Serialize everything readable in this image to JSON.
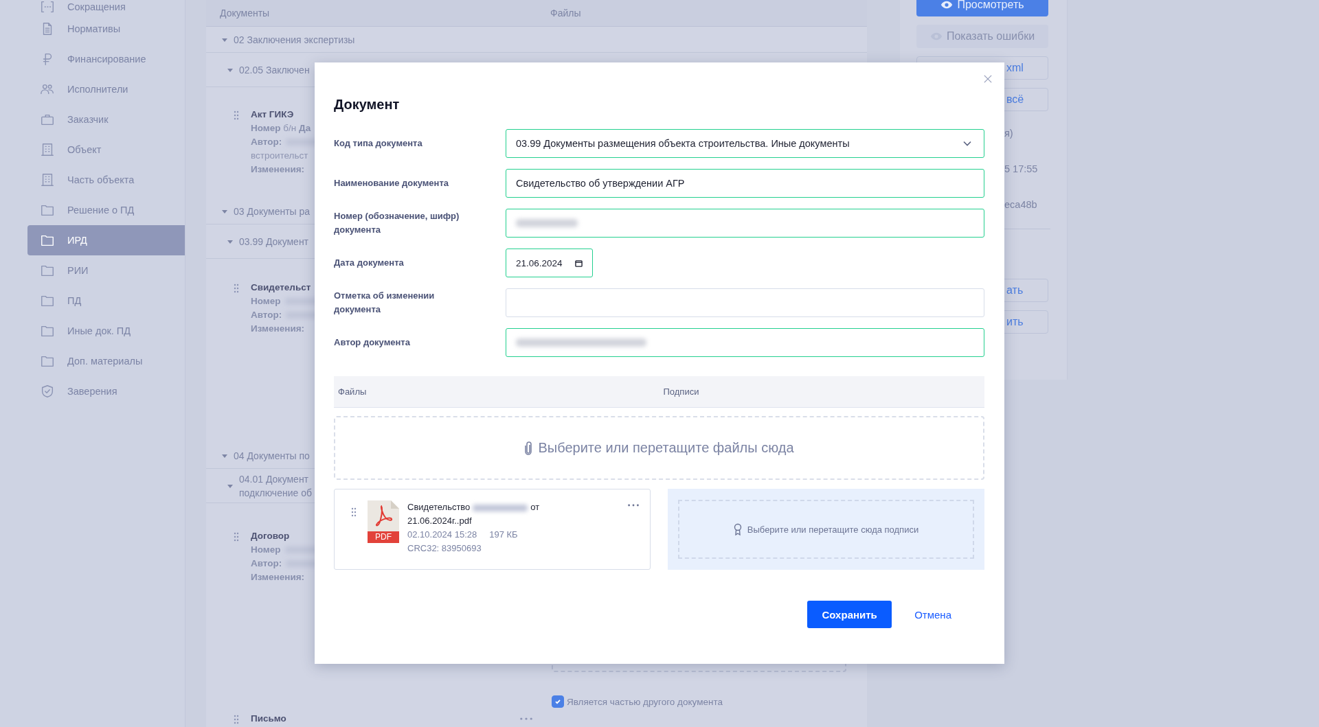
{
  "sidebar": {
    "items": [
      {
        "label": "Сокращения",
        "selected": false
      },
      {
        "label": "Нормативы",
        "selected": false
      },
      {
        "label": "Финансирование",
        "selected": false
      },
      {
        "label": "Исполнители",
        "selected": false
      },
      {
        "label": "Заказчик",
        "selected": false
      },
      {
        "label": "Объект",
        "selected": false
      },
      {
        "label": "Часть объекта",
        "selected": false
      },
      {
        "label": "Решение о ПД",
        "selected": false
      },
      {
        "label": "ИРД",
        "selected": true
      },
      {
        "label": "РИИ",
        "selected": false
      },
      {
        "label": "ПД",
        "selected": false
      },
      {
        "label": "Иные док. ПД",
        "selected": false
      },
      {
        "label": "Доп. материалы",
        "selected": false
      },
      {
        "label": "Заверения",
        "selected": false
      }
    ]
  },
  "documents": {
    "columns": [
      "Документы",
      "Файлы"
    ],
    "groups": [
      {
        "title": "02 Заключения экспертизы",
        "expanded": true,
        "children": [
          {
            "title": "02.05 Заключен",
            "expanded": true,
            "docs": [
              {
                "name": "Акт ГИКЭ",
                "lines": [
                  {
                    "text": "**Номер** б/н **Да**",
                    "redacted": false
                  },
                  {
                    "text": "**Автор:**",
                    "redacted": true
                  },
                  {
                    "text": "встроительст",
                    "redacted": false
                  },
                  {
                    "text": "**Изменения:**",
                    "redacted": false
                  }
                ]
              }
            ]
          }
        ]
      },
      {
        "title": "03 Документы ра",
        "expanded": true,
        "children": [
          {
            "title": "03.99 Документ",
            "expanded": true,
            "docs": [
              {
                "name": "Свидетельст",
                "lines": [
                  {
                    "text": "**Номер**",
                    "redacted": true
                  },
                  {
                    "text": "**Автор:**",
                    "redacted": true
                  },
                  {
                    "text": "**Изменения:**",
                    "redacted": false
                  }
                ]
              }
            ]
          }
        ]
      },
      {
        "title": "04 Документы по",
        "expanded": true,
        "children": [
          {
            "title": "04.01 Документ\nподключение об",
            "expanded": true,
            "docs": [
              {
                "name": "Договор",
                "lines": [
                  {
                    "text": "**Номер**",
                    "redacted": true
                  },
                  {
                    "text": "**Автор:**",
                    "redacted": true
                  },
                  {
                    "text": "**Изменения:**",
                    "redacted": false
                  }
                ],
                "part_of_other": {
                  "label": "Является частью другого документа",
                  "checked": true
                }
              },
              {
                "name": "Письмо",
                "has_menu": true
              }
            ]
          }
        ]
      }
    ]
  },
  "side_panel": {
    "buttons": [
      {
        "label": "Просмотреть",
        "kind": "primary",
        "disabled": false
      },
      {
        "label": "Показать ошибки",
        "kind": "primary",
        "disabled": true
      },
      {
        "label": "xml",
        "kind": "outline",
        "disabled": false
      },
      {
        "label": "всё",
        "kind": "outline",
        "disabled": false
      }
    ],
    "info": [
      "я)",
      "5 17:55",
      "eca48b"
    ],
    "actions": [
      "ать",
      "ить"
    ]
  },
  "dialog": {
    "title": "Документ",
    "fields": [
      {
        "label": "Код типа документа",
        "kind": "select",
        "value": "03.99 Документы размещения объекта строительства. Иные документы",
        "valid": true
      },
      {
        "label": "Наименование документа",
        "kind": "text",
        "value": "Свидетельство об утверждении АГР",
        "valid": true
      },
      {
        "label": "Номер (обозначение, шифр) документа",
        "kind": "redacted",
        "valid": true
      },
      {
        "label": "Дата документа",
        "kind": "date",
        "value": "21.06.2024",
        "valid": true
      },
      {
        "label": "Отметка об изменении документа",
        "kind": "text",
        "valid": false
      },
      {
        "label": "Автор документа",
        "kind": "redacted",
        "valid": true
      }
    ],
    "files_table": {
      "columns": [
        "Файлы",
        "Подписи"
      ],
      "dropzone": "Выберите или перетащите файлы сюда",
      "file": {
        "name_start": "Свидетельство",
        "name_end": "от 21.06.2024г..pdf",
        "type_badge": "PDF",
        "date": "02.10.2024 15:28",
        "size": "197 КБ",
        "checksum": "CRC32: 83950693"
      },
      "signature_dropzone": "Выберите или перетащите сюда подписи"
    },
    "buttons": [
      {
        "label": "Сохранить",
        "kind": "primary"
      },
      {
        "label": "Отмена",
        "kind": "link"
      }
    ]
  }
}
